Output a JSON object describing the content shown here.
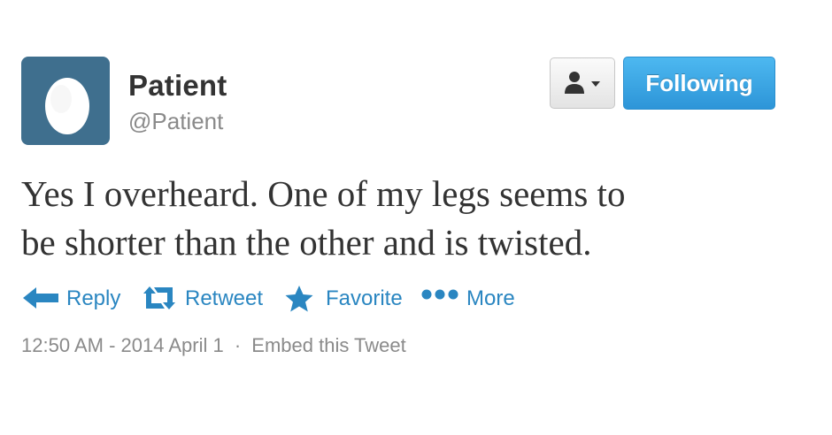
{
  "user": {
    "display_name": "Patient",
    "screen_name": "@Patient",
    "avatar_icon": "egg-icon",
    "avatar_color": "#3f6f8e"
  },
  "header_actions": {
    "user_menu_icon": "user-dropdown-icon",
    "follow_label": "Following",
    "follow_color": "#2d95d8"
  },
  "tweet": {
    "text_line1": "Yes I overheard. One of my legs seems to",
    "text_line2": "be shorter than the other and is twisted."
  },
  "actions": {
    "reply": {
      "label": "Reply",
      "icon": "reply-icon"
    },
    "retweet": {
      "label": "Retweet",
      "icon": "retweet-icon"
    },
    "favorite": {
      "label": "Favorite",
      "icon": "star-icon"
    },
    "more": {
      "label": "More",
      "icon": "more-dots-icon"
    },
    "color": "#2a86c1"
  },
  "meta": {
    "timestamp": "12:50 AM - 2014 April 1",
    "separator": "·",
    "embed_label": "Embed this Tweet"
  }
}
